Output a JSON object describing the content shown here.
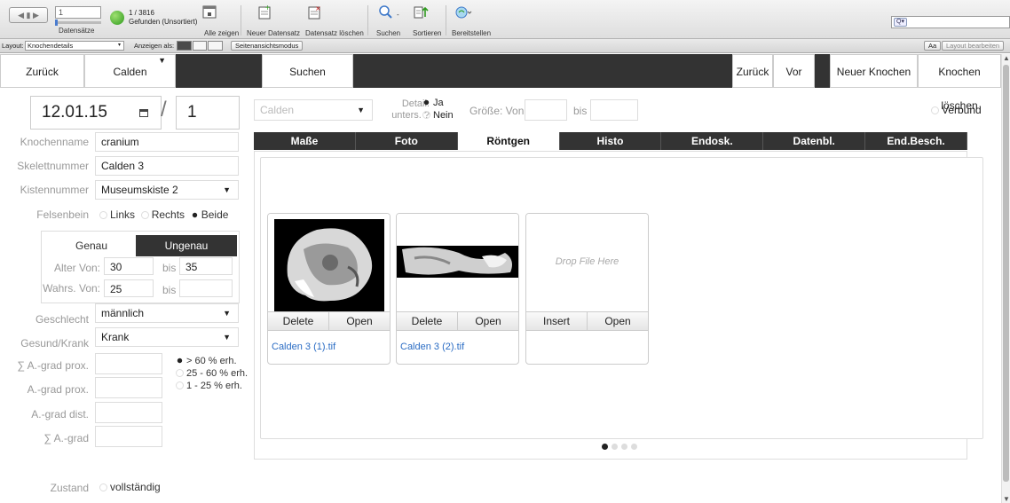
{
  "toolbar": {
    "record_current": "1",
    "records_label": "Datensätze",
    "found_count": "1 / 3816",
    "found_status": "Gefunden (Unsortiert)",
    "show_all": "Alle zeigen",
    "new_record": "Neuer Datensatz",
    "delete_record": "Datensatz löschen",
    "search": "Suchen",
    "sort": "Sortieren",
    "share": "Bereitstellen"
  },
  "layoutbar": {
    "layout_label": "Layout:",
    "layout_value": "Knochendetails",
    "view_as": "Anzeigen als:",
    "preview_mode": "Seitenansichtsmodus",
    "font_btn": "Aa",
    "edit_layout": "Layout bearbeiten"
  },
  "nav": {
    "back": "Zurück",
    "site": "Calden",
    "search": "Suchen",
    "prev": "Zurück",
    "next": "Vor",
    "new_bone": "Neuer Knochen",
    "delete_bone": "Knochen löschen"
  },
  "form": {
    "date": "12.01.15",
    "separator": "/",
    "number": "1",
    "bone_name_label": "Knochenname",
    "bone_name": "cranium",
    "skeleton_label": "Skelettnummer",
    "skeleton": "Calden 3",
    "box_label": "Kistennummer",
    "box": "Museumskiste 2",
    "petrous_label": "Felsenbein",
    "petrous_left": "Links",
    "petrous_right": "Rechts",
    "petrous_both": "Beide",
    "tab_exact": "Genau",
    "tab_inexact": "Ungenau",
    "age_from_label": "Alter Von:",
    "age_from": "30",
    "to_label": "bis",
    "age_to": "35",
    "prob_from_label": "Wahrs. Von:",
    "prob_from": "25",
    "prob_to": "",
    "sex_label": "Geschlecht",
    "sex": "männlich",
    "health_label": "Gesund/Krank",
    "health": "Krank",
    "sum_prox_label": "∑ A.-grad prox.",
    "prox_label": "A.-grad prox.",
    "dist_label": "A.-grad dist.",
    "sum_label": "∑ A.-grad",
    "opt1": "> 60 % erh.",
    "opt2": "25 - 60 % erh.",
    "opt3": "1 - 25 % erh.",
    "state_label": "Zustand",
    "state_complete": "vollständig"
  },
  "filter": {
    "site_placeholder": "Calden",
    "detail_label": "Detail. unters. ?",
    "yes": "Ja",
    "no": "Nein",
    "size_label": "Größe: Von",
    "size_to": "bis",
    "compound": "Verbund"
  },
  "tabs": [
    {
      "label": "Maße"
    },
    {
      "label": "Foto"
    },
    {
      "label": "Röntgen"
    },
    {
      "label": "Histo"
    },
    {
      "label": "Endosk."
    },
    {
      "label": "Datenbl."
    },
    {
      "label": "End.Besch."
    }
  ],
  "cards": [
    {
      "btn1": "Delete",
      "btn2": "Open",
      "file": "Calden 3 (1).tif"
    },
    {
      "btn1": "Delete",
      "btn2": "Open",
      "file": "Calden 3 (2).tif"
    },
    {
      "btn1": "Insert",
      "btn2": "Open",
      "file": "",
      "drop": "Drop File Here"
    }
  ]
}
